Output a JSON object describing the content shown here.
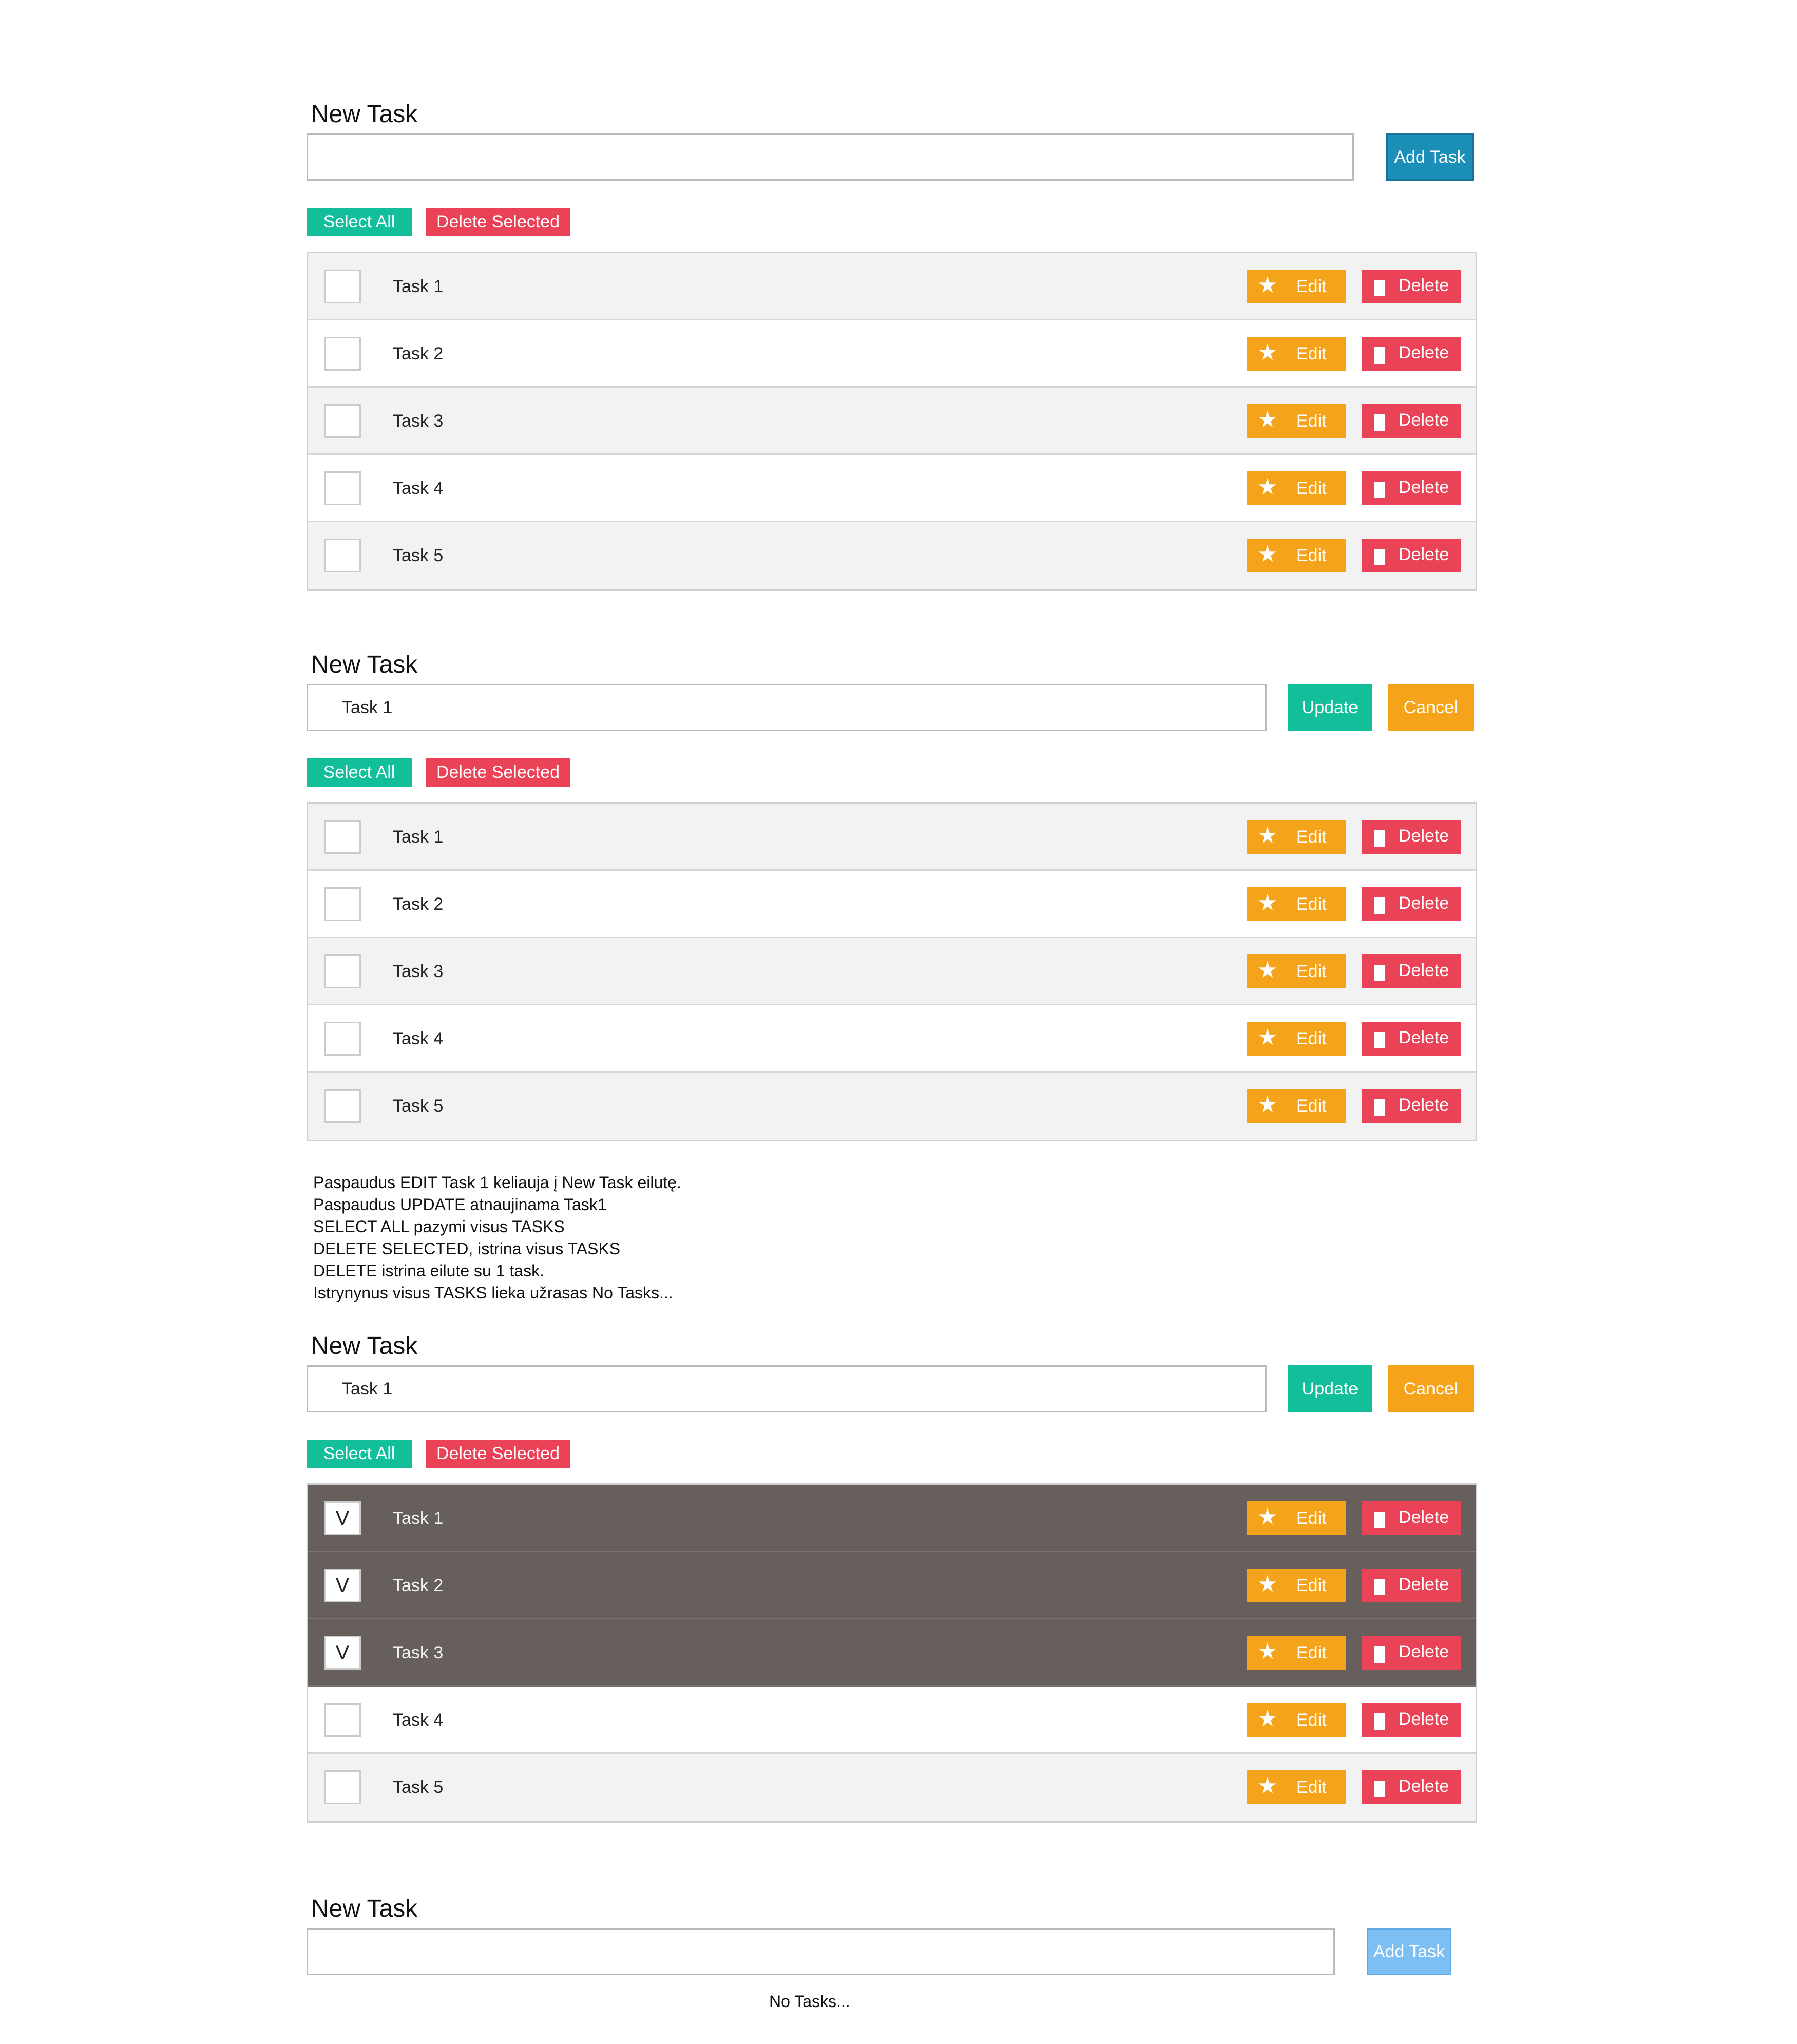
{
  "colors": {
    "green": "#13bf9a",
    "orange": "#f5a31a",
    "red": "#ea4257",
    "blue": "#1b8fb8",
    "light_blue": "#7cc0f3",
    "selected_row": "#665f5c"
  },
  "icons": {
    "edit": "star-icon",
    "delete": "trash-icon",
    "check": "check-mark"
  },
  "screen1": {
    "label": "New Task",
    "input_value": "",
    "add_button": "Add Task",
    "select_all": "Select All",
    "delete_selected": "Delete Selected",
    "tasks": [
      {
        "name": "Task 1",
        "checked": false
      },
      {
        "name": "Task 2",
        "checked": false
      },
      {
        "name": "Task 3",
        "checked": false
      },
      {
        "name": "Task 4",
        "checked": false
      },
      {
        "name": "Task 5",
        "checked": false
      }
    ],
    "edit_label": "Edit",
    "delete_label": "Delete"
  },
  "screen2": {
    "label": "New Task",
    "input_value": "Task 1",
    "update_button": "Update",
    "cancel_button": "Cancel",
    "select_all": "Select All",
    "delete_selected": "Delete Selected",
    "tasks": [
      {
        "name": "Task 1",
        "checked": false
      },
      {
        "name": "Task 2",
        "checked": false
      },
      {
        "name": "Task 3",
        "checked": false
      },
      {
        "name": "Task 4",
        "checked": false
      },
      {
        "name": "Task 5",
        "checked": false
      }
    ],
    "edit_label": "Edit",
    "delete_label": "Delete"
  },
  "notes": [
    "Paspaudus EDIT Task 1 keliauja į New Task eilutę.",
    "Paspaudus UPDATE atnaujinama Task1",
    "SELECT ALL pazymi visus TASKS",
    "DELETE SELECTED, istrina visus TASKS",
    "DELETE istrina eilute su 1 task.",
    "Istrynynus visus TASKS lieka užrasas No Tasks..."
  ],
  "screen3": {
    "label": "New Task",
    "input_value": "Task 1",
    "update_button": "Update",
    "cancel_button": "Cancel",
    "select_all": "Select All",
    "delete_selected": "Delete Selected",
    "check_mark": "V",
    "tasks": [
      {
        "name": "Task 1",
        "checked": true
      },
      {
        "name": "Task 2",
        "checked": true
      },
      {
        "name": "Task 3",
        "checked": true
      },
      {
        "name": "Task 4",
        "checked": false
      },
      {
        "name": "Task 5",
        "checked": false
      }
    ],
    "edit_label": "Edit",
    "delete_label": "Delete"
  },
  "screen4": {
    "label": "New Task",
    "input_value": "",
    "add_button": "Add Task",
    "empty_message": "No Tasks..."
  }
}
